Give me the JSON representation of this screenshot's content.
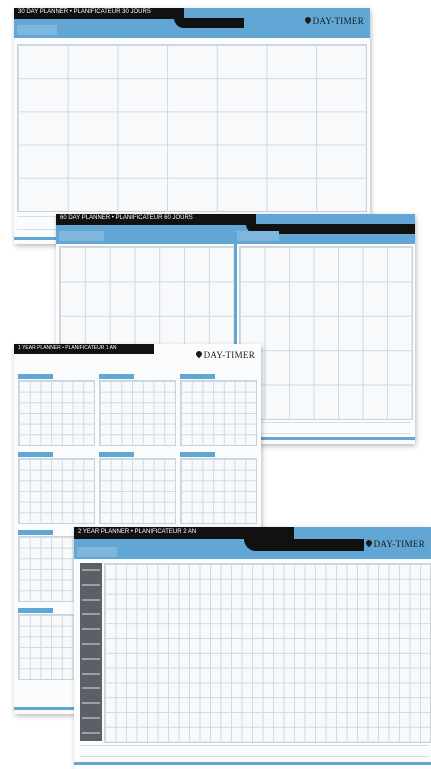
{
  "planners": {
    "p30": {
      "title": "30 DAY PLANNER • PLANIFICATEUR 30 JOURS",
      "logo": "DAY-TIMER"
    },
    "p60": {
      "title": "60 DAY PLANNER • PLANIFICATEUR 60 JOURS"
    },
    "p12": {
      "title": "1 YEAR PLANNER • PLANIFICATEUR 1 AN",
      "logo": "DAY-TIMER"
    },
    "p2y": {
      "title": "2 YEAR PLANNER • PLANIFICATEUR 2 AN",
      "logo": "DAY-TIMER"
    }
  }
}
